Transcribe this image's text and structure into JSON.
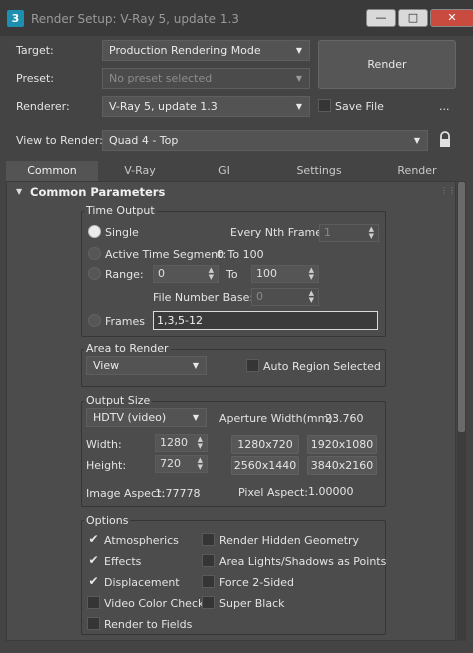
{
  "window": {
    "title": "Render Setup: V-Ray 5, update 1.3",
    "app_icon": "3"
  },
  "header": {
    "target_label": "Target:",
    "target_value": "Production Rendering Mode",
    "preset_label": "Preset:",
    "preset_value": "No preset selected",
    "renderer_label": "Renderer:",
    "renderer_value": "V-Ray 5, update 1.3",
    "save_file_label": "Save File",
    "more_label": "...",
    "view_label": "View to Render:",
    "view_value": "Quad 4 - Top",
    "render_label": "Render"
  },
  "tabs": [
    {
      "label": "Common"
    },
    {
      "label": "V-Ray"
    },
    {
      "label": "GI"
    },
    {
      "label": "Settings"
    },
    {
      "label": "Render Elements"
    }
  ],
  "rollout": {
    "title": "Common Parameters"
  },
  "time_output": {
    "title": "Time Output",
    "single_label": "Single",
    "nth_label": "Every Nth Frame:",
    "nth_value": "1",
    "active_label": "Active Time Segment:",
    "active_value": "0 To 100",
    "range_label": "Range:",
    "range_from": "0",
    "to_label": "To",
    "range_to": "100",
    "file_base_label": "File Number Base:",
    "file_base_value": "0",
    "frames_label": "Frames",
    "frames_value": "1,3,5-12"
  },
  "area": {
    "title": "Area to Render",
    "mode": "View",
    "auto_region_label": "Auto Region Selected"
  },
  "output_size": {
    "title": "Output Size",
    "preset": "HDTV (video)",
    "aperture_label": "Aperture Width(mm):",
    "aperture_value": "23.760",
    "width_label": "Width:",
    "width_value": "1280",
    "height_label": "Height:",
    "height_value": "720",
    "presets": [
      "1280x720",
      "1920x1080",
      "2560x1440",
      "3840x2160"
    ],
    "image_aspect_label": "Image Aspect:",
    "image_aspect_value": "1.77778",
    "pixel_aspect_label": "Pixel Aspect:",
    "pixel_aspect_value": "1.00000"
  },
  "options": {
    "title": "Options",
    "atmospherics": "Atmospherics",
    "effects": "Effects",
    "displacement": "Displacement",
    "video_color_check": "Video Color Check",
    "render_fields": "Render to Fields",
    "hidden_geometry": "Render Hidden Geometry",
    "area_lights": "Area Lights/Shadows as Points",
    "force_2sided": "Force 2-Sided",
    "super_black": "Super Black"
  }
}
